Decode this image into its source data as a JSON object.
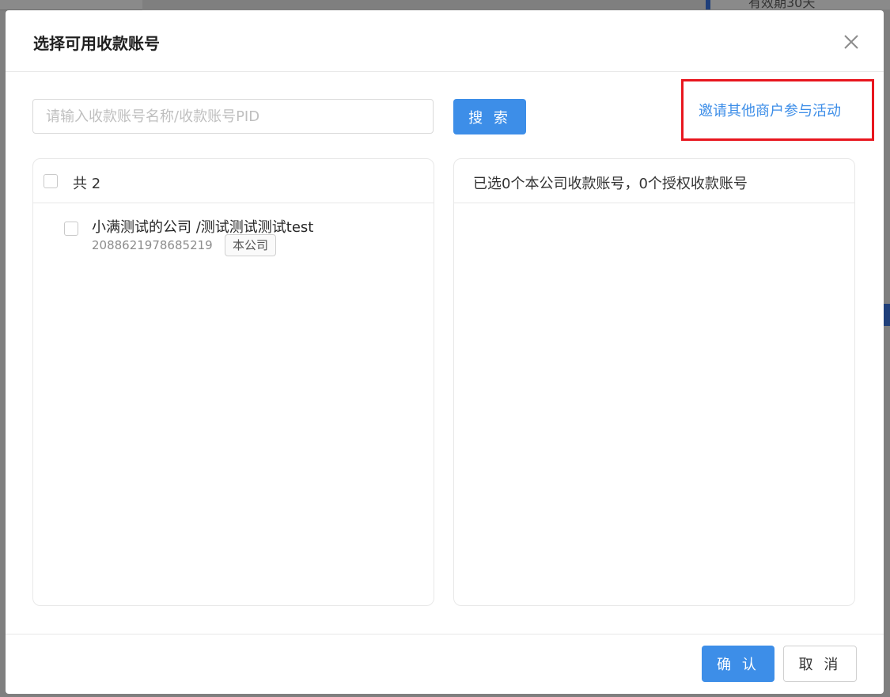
{
  "background": {
    "top_right_text": "有效期30天"
  },
  "modal": {
    "title": "选择可用收款账号",
    "close_icon": "close-icon"
  },
  "search": {
    "placeholder": "请输入收款账号名称/收款账号PID",
    "value": "",
    "button_label": "搜 索"
  },
  "invite": {
    "link_label": "邀请其他商户参与活动",
    "highlight_color": "#e8161e"
  },
  "left_panel": {
    "header_label": "共 2",
    "items": [
      {
        "name": "小满测试的公司 /测试测试测试test",
        "pid": "2088621978685219",
        "tag": "本公司"
      }
    ]
  },
  "right_panel": {
    "header_label": "已选0个本公司收款账号，0个授权收款账号"
  },
  "footer": {
    "ok_label": "确 认",
    "cancel_label": "取 消"
  },
  "colors": {
    "primary": "#3d8ee8",
    "overlay": "#7f7f7f"
  }
}
